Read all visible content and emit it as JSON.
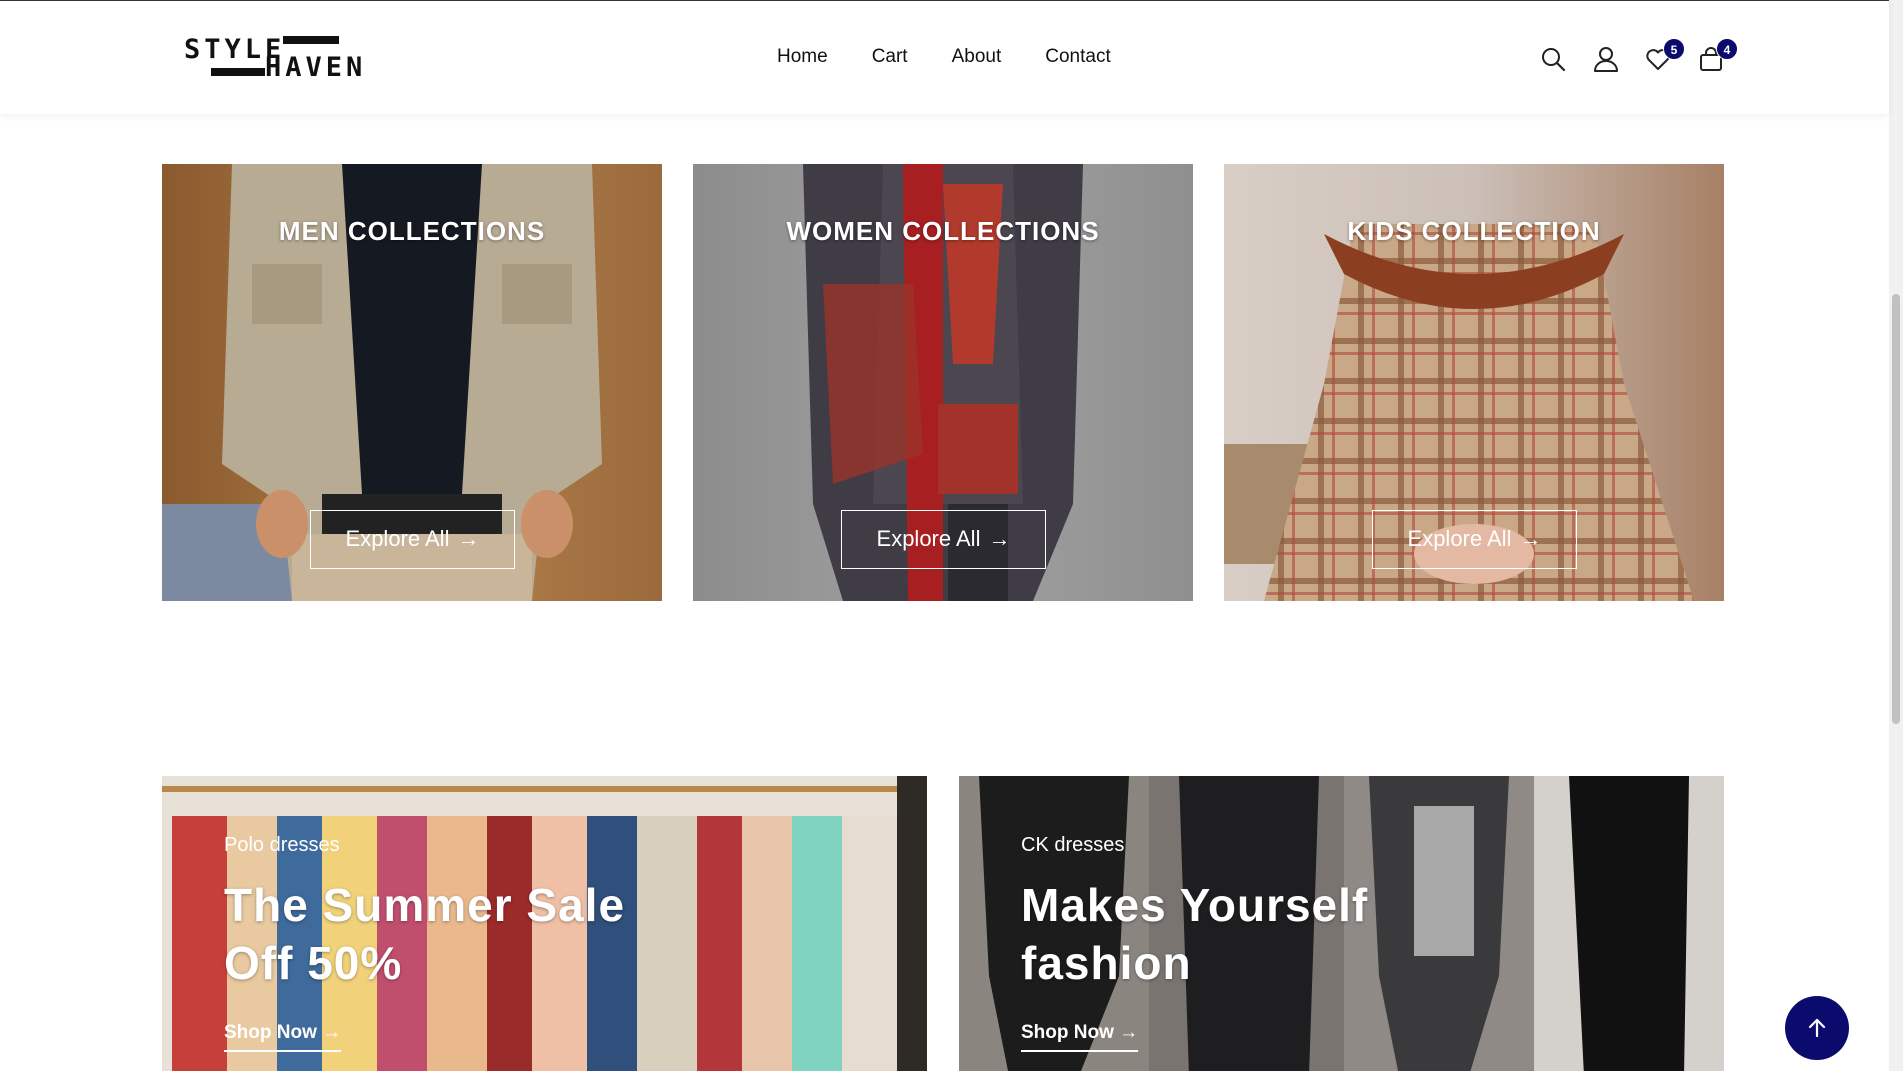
{
  "header": {
    "logo": {
      "line1": "STYLE",
      "line2": "HAVEN"
    },
    "nav": [
      {
        "label": "Home"
      },
      {
        "label": "Cart"
      },
      {
        "label": "About"
      },
      {
        "label": "Contact"
      }
    ],
    "icons": {
      "wishlist_count": "5",
      "cart_count": "4"
    },
    "badge_color": "#0b0b6e"
  },
  "collections": [
    {
      "title": "MEN COLLECTIONS",
      "button": "Explore All"
    },
    {
      "title": "WOMEN COLLECTIONS",
      "button": "Explore All"
    },
    {
      "title": "KIDS COLLECTION",
      "button": "Explore All"
    }
  ],
  "banners": [
    {
      "subtitle": "Polo dresses",
      "heading_line1": "The Summer Sale",
      "heading_line2": "Off 50%",
      "link": "Shop Now"
    },
    {
      "subtitle": "CK dresses",
      "heading_line1": "Makes Yourself",
      "heading_line2": "fashion",
      "link": "Shop Now"
    }
  ],
  "colors": {
    "accent": "#0b0b6e"
  }
}
